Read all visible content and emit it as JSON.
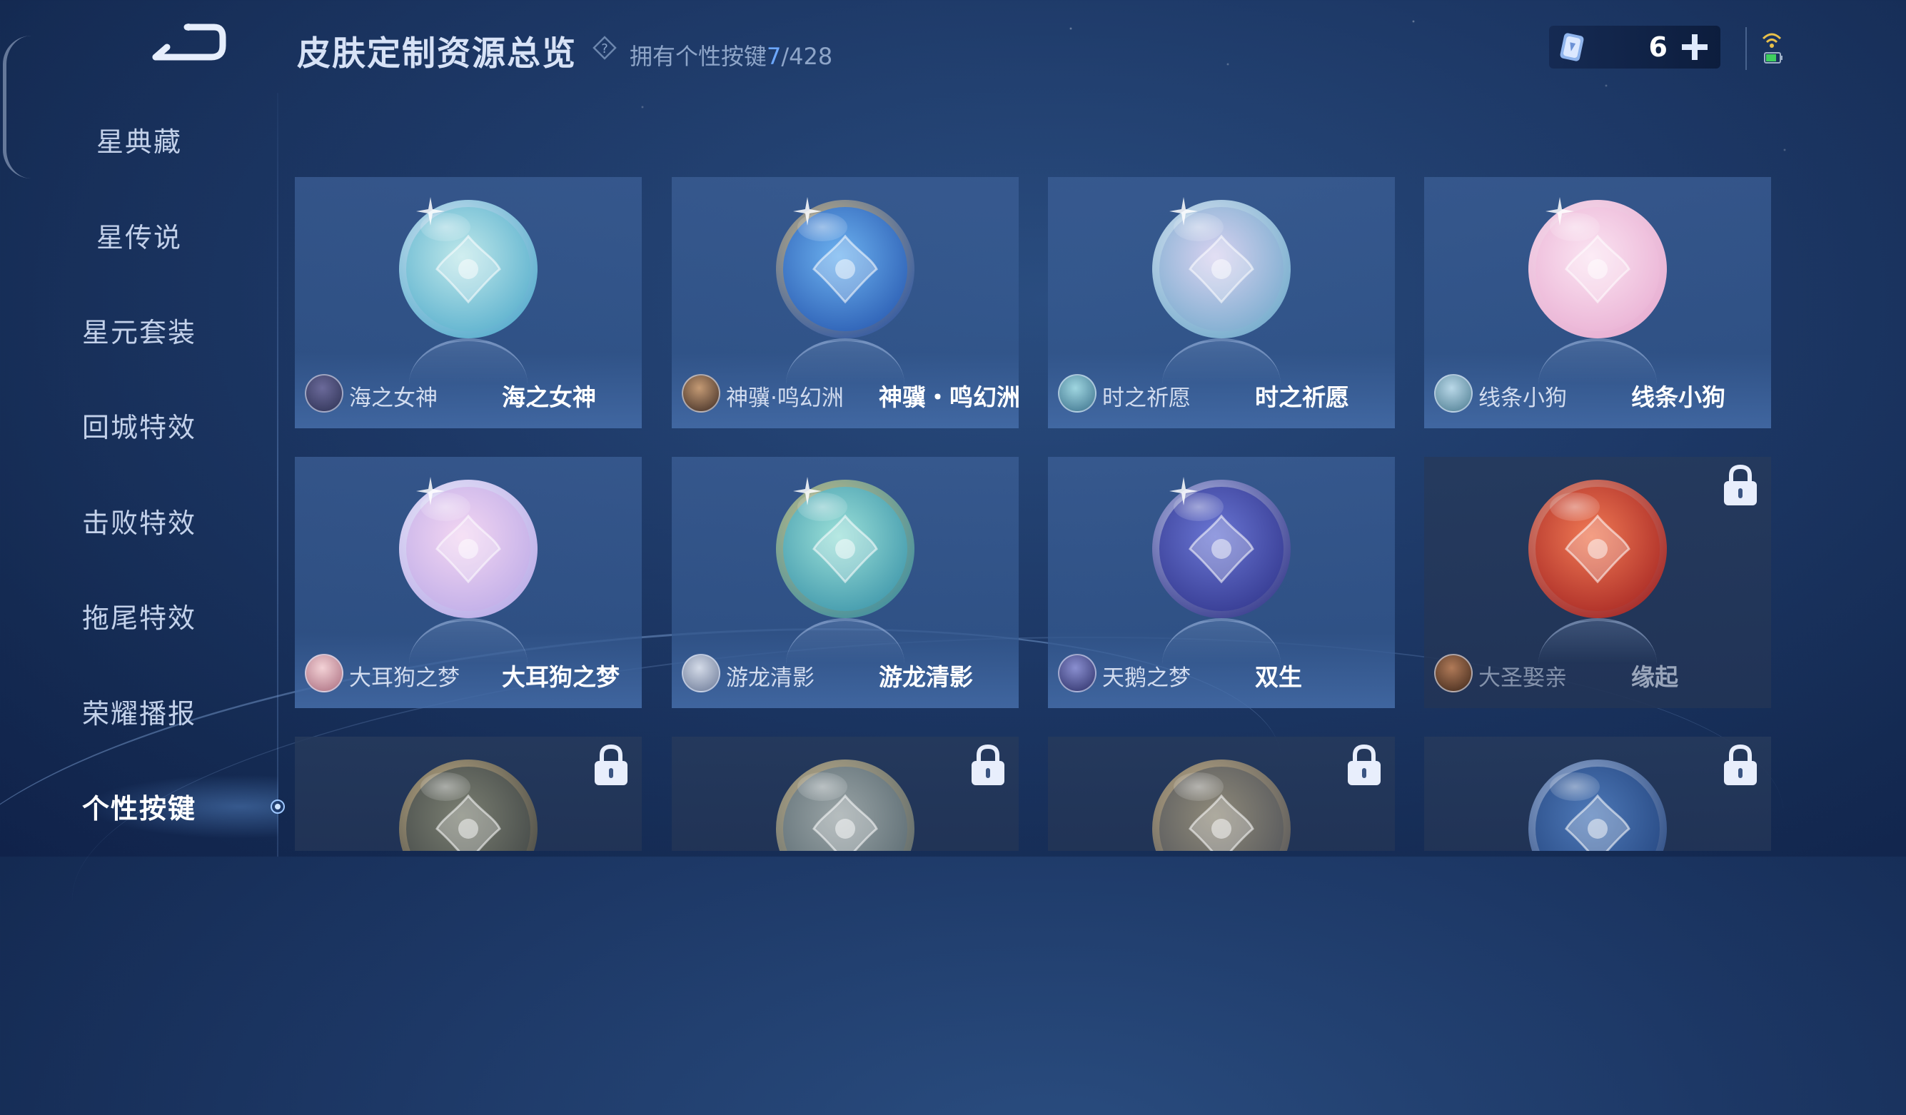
{
  "header": {
    "title": "皮肤定制资源总览",
    "owned_label": "拥有个性按键",
    "owned_count": "7",
    "owned_total": "/428",
    "help_icon": "question-icon"
  },
  "currency": {
    "value": "6",
    "icon": "coupon-icon",
    "add_icon": "plus-icon"
  },
  "sidebar": {
    "items": [
      {
        "label": "星典藏"
      },
      {
        "label": "星传说"
      },
      {
        "label": "星元套装"
      },
      {
        "label": "回城特效"
      },
      {
        "label": "击败特效"
      },
      {
        "label": "拖尾特效"
      },
      {
        "label": "荣耀播报"
      },
      {
        "label": "个性按键"
      }
    ],
    "active_index": 7
  },
  "cards": [
    {
      "skin": "海之女神",
      "key": "海之女神",
      "locked": false,
      "colors": [
        "#bfe8ea",
        "#4aa7c9"
      ],
      "ring": "#dfe9f5",
      "avatar": [
        "#6b6a9a",
        "#2c3052"
      ]
    },
    {
      "skin": "神骥·鸣幻洲",
      "key": "神骥・鸣幻洲",
      "locked": false,
      "colors": [
        "#6db2f0",
        "#1f4ea8"
      ],
      "ring": "#e0c27a",
      "avatar": [
        "#c49a74",
        "#3c2a22"
      ]
    },
    {
      "skin": "时之祈愿",
      "key": "时之祈愿",
      "locked": false,
      "colors": [
        "#d8d2f0",
        "#6aa6c9"
      ],
      "ring": "#e3e8f5",
      "avatar": [
        "#9fd6e0",
        "#3a6f8a"
      ]
    },
    {
      "skin": "线条小狗",
      "key": "线条小狗",
      "locked": false,
      "colors": [
        "#fbe4f2",
        "#e7a9cf"
      ],
      "ring": "#f6e3ef",
      "avatar": [
        "#b9d8e8",
        "#4a7a8f"
      ]
    },
    {
      "skin": "大耳狗之梦",
      "key": "大耳狗之梦",
      "locked": false,
      "colors": [
        "#f3d6f2",
        "#b6a6e6"
      ],
      "ring": "#eef0fb",
      "avatar": [
        "#f3d2d6",
        "#a96b7d"
      ]
    },
    {
      "skin": "游龙清影",
      "key": "游龙清影",
      "locked": false,
      "colors": [
        "#9be0d8",
        "#2f8aa3"
      ],
      "ring": "#dcc27f",
      "avatar": [
        "#d4dbe8",
        "#6a7896"
      ]
    },
    {
      "skin": "天鹅之梦",
      "key": "双生",
      "locked": false,
      "colors": [
        "#6a76d4",
        "#2b2f84"
      ],
      "ring": "#c3cbef",
      "avatar": [
        "#8a8fd0",
        "#2b2e66"
      ]
    },
    {
      "skin": "大圣娶亲",
      "key": "缘起",
      "locked": true,
      "colors": [
        "#f07a55",
        "#9e1d1d"
      ],
      "ring": "#e6a38b",
      "avatar": [
        "#b07a58",
        "#3d2619"
      ]
    },
    {
      "skin": "",
      "key": "",
      "locked": true,
      "colors": [
        "#7b7f72",
        "#3a3f40"
      ],
      "ring": "#c9b48a",
      "avatar": [
        "#555",
        "#333"
      ]
    },
    {
      "skin": "",
      "key": "",
      "locked": true,
      "colors": [
        "#9aa4a6",
        "#51626a"
      ],
      "ring": "#c9b48a",
      "avatar": [
        "#555",
        "#333"
      ]
    },
    {
      "skin": "",
      "key": "",
      "locked": true,
      "colors": [
        "#8f8a7a",
        "#4a4d55"
      ],
      "ring": "#c9b48a",
      "avatar": [
        "#555",
        "#333"
      ]
    },
    {
      "skin": "",
      "key": "",
      "locked": true,
      "colors": [
        "#4e79b8",
        "#1f3f78"
      ],
      "ring": "#a7bde0",
      "avatar": [
        "#555",
        "#333"
      ]
    }
  ]
}
